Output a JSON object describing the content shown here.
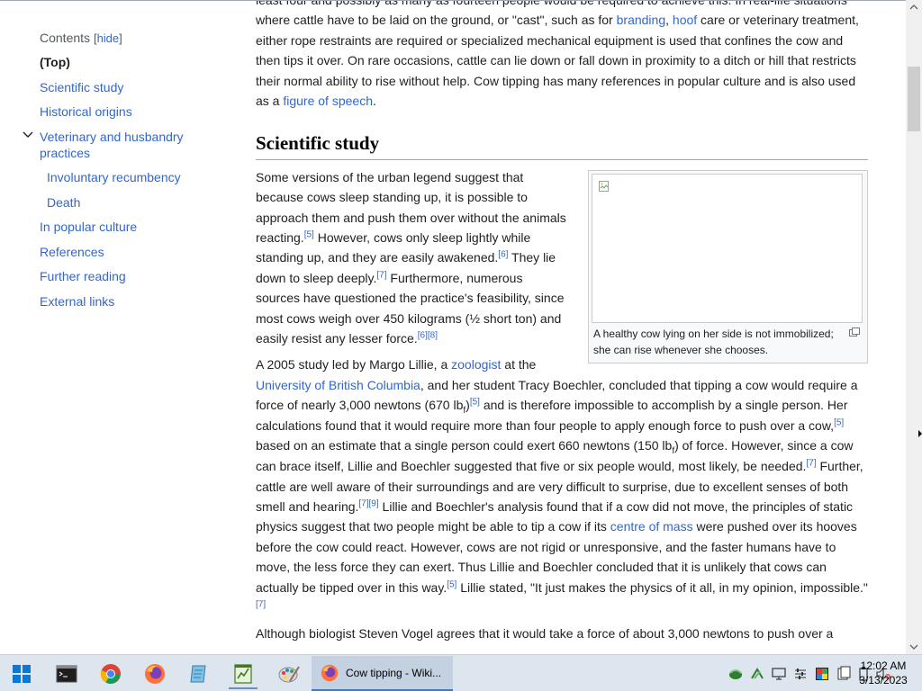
{
  "toc": {
    "title": "Contents",
    "hide_open": "[",
    "hide_label": "hide",
    "hide_close": "]",
    "items": [
      {
        "label": "(Top)"
      },
      {
        "label": "Scientific study"
      },
      {
        "label": "Historical origins"
      },
      {
        "label": "Veterinary and husbandry practices"
      },
      {
        "label": "Involuntary recumbency"
      },
      {
        "label": "Death"
      },
      {
        "label": "In popular culture"
      },
      {
        "label": "References"
      },
      {
        "label": "Further reading"
      },
      {
        "label": "External links"
      }
    ]
  },
  "article": {
    "intro": {
      "t1": "least four and possibly as many as fourteen people would be required to achieve this. In real-life situations where cattle have to be laid on the ground, or \"cast\", such as for ",
      "link1": "branding",
      "t2": ", ",
      "link2": "hoof",
      "t3": " care or veterinary treatment, either rope restraints are required or specialized mechanical equipment is used that confines the cow and then tips it over. On rare occasions, cattle can lie down or fall down in proximity to a ditch or hill that restricts their normal ability to rise without help. Cow tipping has many references in popular culture and is also used as a ",
      "link3": "figure of speech",
      "t4": "."
    },
    "section_heading": "Scientific study",
    "figure": {
      "caption": "A healthy cow lying on her side is not immobilized; she can rise whenever she chooses."
    },
    "p1": {
      "t1": "Some versions of the urban legend suggest that because cows sleep standing up, it is possible to approach them and push them over without the animals reacting.",
      "ref1": "[5]",
      "t2": " However, cows only sleep lightly while standing up, and they are easily awakened.",
      "ref2": "[6]",
      "t3": " They lie down to sleep deeply.",
      "ref3": "[7]",
      "t4": " Furthermore, numerous sources have questioned the practice's feasibility, since most cows weigh over 450 kilograms (",
      "fraction": "½",
      "t5": " short ton) and easily resist any lesser force.",
      "ref4": "[6]",
      "ref5": "[8]"
    },
    "p2": {
      "t1": "A 2005 study led by Margo Lillie, a ",
      "link1": "zoologist",
      "t2": " at the ",
      "link2": "University of British Columbia",
      "t3": ", and her student Tracy Boechler, concluded that tipping a cow would require a force of nearly 3,000 newtons (670 lb",
      "sub1": "f",
      "t3b": ")",
      "ref1": "[5]",
      "t4": " and is therefore impossible to accomplish by a single person. Her calculations found that it would require more than four people to apply enough force to push over a cow,",
      "ref2": "[5]",
      "t5": " based on an estimate that a single person could exert 660 newtons (150 lb",
      "sub2": "f",
      "t5b": ") of force. However, since a cow can brace itself, Lillie and Boechler suggested that five or six people would, most likely, be needed.",
      "ref3": "[7]",
      "t6": " Further, cattle are well aware of their surroundings and are very difficult to surprise, due to excellent senses of both smell and hearing.",
      "ref4": "[7]",
      "ref5": "[9]",
      "t7": " Lillie and Boechler's analysis found that if a cow did not move, the principles of static physics suggest that two people might be able to tip a cow if its ",
      "link3": "centre of mass",
      "t8": " were pushed over its hooves before the cow could react. However, cows are not rigid or unresponsive, and the faster humans have to move, the less force they can exert. Thus Lillie and Boechler concluded that it is unlikely that cows can actually be tipped over in this way.",
      "ref6": "[5]",
      "t9": " Lillie stated, \"It just makes the physics of it all, in my opinion, impossible.\"",
      "ref7": "[7]"
    },
    "p3": {
      "t1": "Although biologist Steven Vogel agrees that it would take a force of about 3,000 newtons to push over a"
    }
  },
  "taskbar": {
    "active_task": "Cow tipping - Wiki...",
    "clock_time": "12:02 AM",
    "clock_date": "3/13/2023"
  },
  "colors": {
    "link": "#3366cc",
    "taskbar_bg": "#dde5ee",
    "active_task_bg": "#c3d1e0"
  },
  "icons": [
    "start-icon",
    "terminal-icon",
    "chrome-icon",
    "firefox-icon",
    "notepad-icon",
    "chart-app-icon",
    "paint-icon"
  ]
}
